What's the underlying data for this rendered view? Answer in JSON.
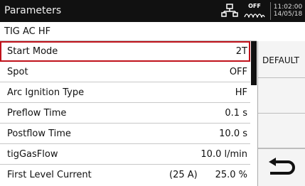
{
  "header": {
    "title": "Parameters",
    "gas_status": "OFF",
    "time": "11:02:00",
    "date": "14/05/18"
  },
  "subtitle": "TIG AC HF",
  "parameters": [
    {
      "label": "Start Mode",
      "value": "2T",
      "selected": true
    },
    {
      "label": "Spot",
      "value": "OFF"
    },
    {
      "label": "Arc Ignition Type",
      "value": "HF"
    },
    {
      "label": "Preflow Time",
      "value": "0.1 s"
    },
    {
      "label": "Postflow Time",
      "value": "10.0 s"
    },
    {
      "label": "tigGasFlow",
      "value": "10.0 l/min"
    },
    {
      "label": "First Level Current",
      "extra": "(25 A)",
      "value": "25.0 %"
    }
  ],
  "side_panel": {
    "default_label": "DEFAULT"
  },
  "icons": {
    "network": "network-icon",
    "gas": "gas-flow-icon",
    "back": "back-arrow-icon"
  },
  "colors": {
    "header_bg": "#111111",
    "selection_border": "#c0121b",
    "side_bg": "#f4f4f4"
  }
}
